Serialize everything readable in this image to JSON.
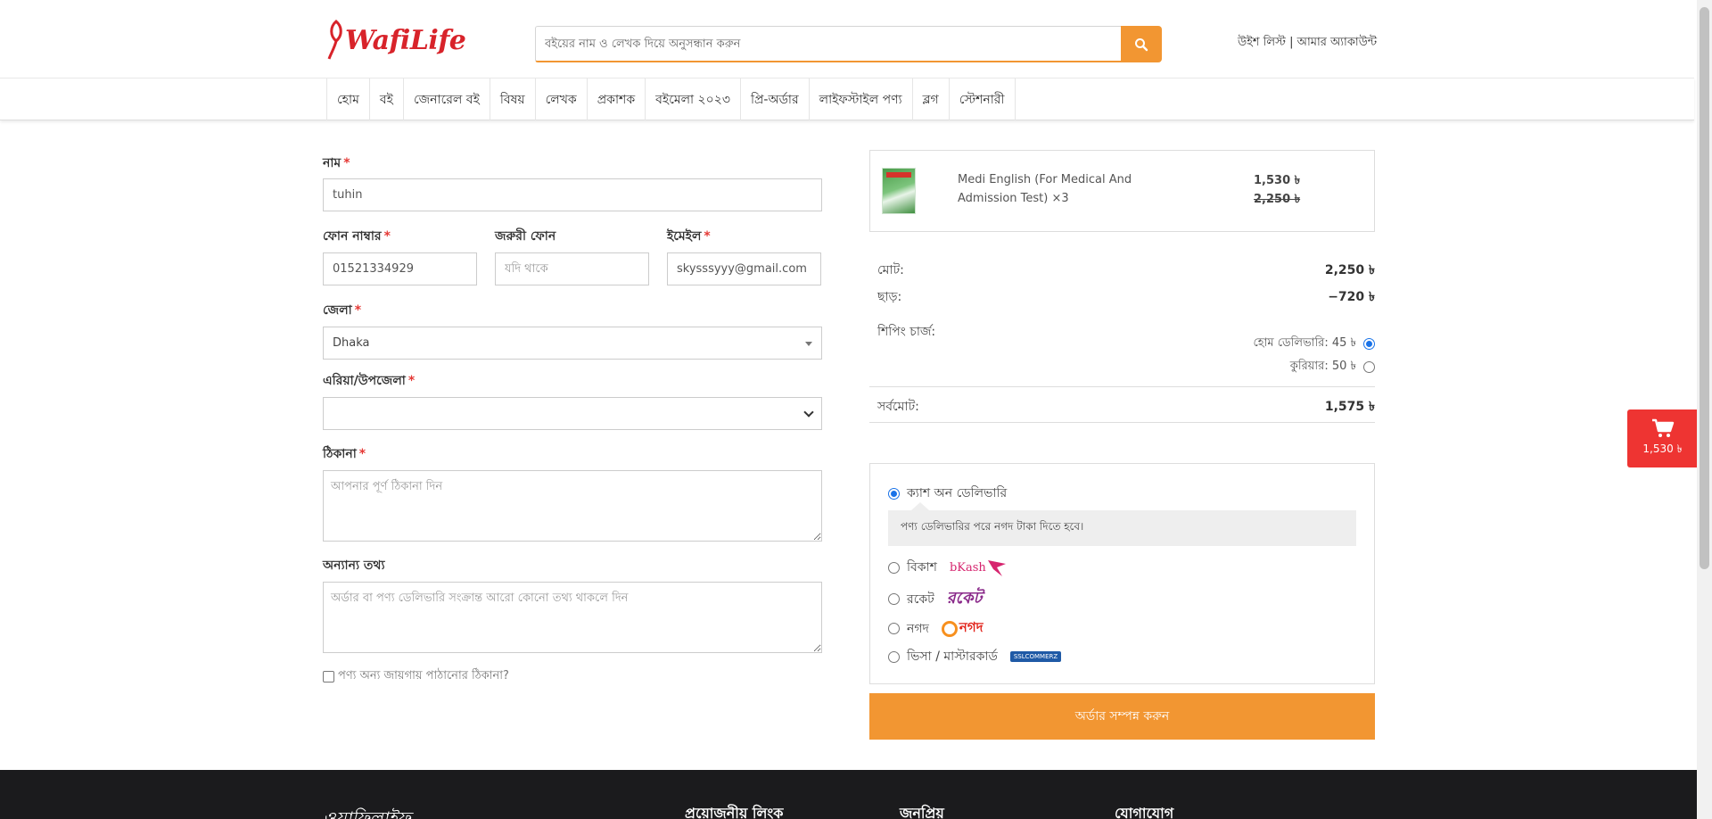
{
  "header": {
    "logo": "WafiLife",
    "search_placeholder": "বইয়ের নাম ও লেখক দিয়ে অনুসন্ধান করুন",
    "wishlist": "উইশ লিস্ট",
    "separator": "|",
    "account": "আমার অ্যাকাউন্ট",
    "accent_color": "#f29632",
    "brand_color": "#d8232a"
  },
  "nav": {
    "items": [
      "হোম",
      "বই",
      "জেনারেল বই",
      "বিষয়",
      "লেখক",
      "প্রকাশক",
      "বইমেলা ২০২৩",
      "প্রি-অর্ডার",
      "লাইফস্টাইল পণ্য",
      "ব্লগ",
      "স্টেশনারী"
    ]
  },
  "form": {
    "name_label": "নাম",
    "name_value": "tuhin",
    "phone_label": "ফোন নাম্বার",
    "phone_value": "01521334929",
    "alt_phone_label": "জরুরী ফোন",
    "alt_phone_placeholder": "যদি থাকে",
    "email_label": "ইমেইল",
    "email_value": "skysssyyy@gmail.com",
    "district_label": "জেলা",
    "district_value": "Dhaka",
    "area_label": "এরিয়া/উপজেলা",
    "area_value": "",
    "address_label": "ঠিকানা",
    "address_placeholder": "আপনার পূর্ণ ঠিকানা দিন",
    "other_label": "অন্যান্য তথ্য",
    "other_placeholder": "অর্ডার বা পণ্য ডেলিভারি সংক্রান্ত আরো কোনো তথ্য থাকলে দিন",
    "ship_elsewhere": "পণ্য অন্য জায়গায় পাঠানোর ঠিকানা?",
    "required_mark": "*"
  },
  "cart": {
    "product_name": "Medi English (For Medical And Admission Test)",
    "quantity": "×3",
    "price_now": "1,530 ৳",
    "price_old": "2,250 ৳"
  },
  "summary": {
    "total_label": "মোট:",
    "total_value": "2,250 ৳",
    "discount_label": "ছাড়:",
    "discount_value": "−720 ৳",
    "shipping_label": "শিপিং চার্জ:",
    "ship_home": "হোম ডেলিভারি: 45 ৳",
    "ship_courier": "কুরিয়ার: 50 ৳",
    "grand_label": "সর্বমোট:",
    "grand_value": "1,575 ৳"
  },
  "payment": {
    "cod": "ক্যাশ অন ডেলিভারি",
    "cod_note": "পণ্য ডেলিভারির পরে নগদ টাকা দিতে হবে।",
    "bkash": "বিকাশ",
    "bkash_logo": "bKash",
    "rocket": "রকেট",
    "rocket_logo": "রকেট",
    "nagad": "নগদ",
    "nagad_logo": "নগদ",
    "card": "ভিসা / মাস্টারকার্ড",
    "ssl_logo": "SSLCOMMERZ",
    "submit": "অর্ডার সম্পন্ন করুন"
  },
  "float_cart": {
    "amount": "1,530 ৳"
  },
  "footer": {
    "logo": "ওয়াফিলাইফ",
    "col1": "প্রয়োজনীয় লিংক",
    "col2": "জনপ্রিয়",
    "col3": "যোগাযোগ"
  }
}
